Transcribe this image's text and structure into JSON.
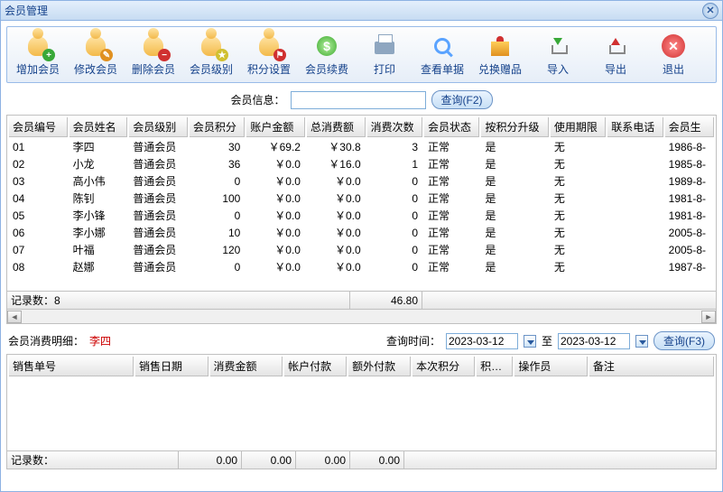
{
  "window": {
    "title": "会员管理"
  },
  "toolbar": [
    {
      "name": "add-member-button",
      "label": "增加会员",
      "icon": "person-add"
    },
    {
      "name": "edit-member-button",
      "label": "修改会员",
      "icon": "person-edit"
    },
    {
      "name": "delete-member-button",
      "label": "删除会员",
      "icon": "person-del"
    },
    {
      "name": "member-level-button",
      "label": "会员级别",
      "icon": "person-lvl"
    },
    {
      "name": "points-setting-button",
      "label": "积分设置",
      "icon": "person-pts"
    },
    {
      "name": "member-renew-button",
      "label": "会员续费",
      "icon": "coin"
    },
    {
      "name": "print-button",
      "label": "打印",
      "icon": "print"
    },
    {
      "name": "view-receipt-button",
      "label": "查看单据",
      "icon": "magnifier"
    },
    {
      "name": "exchange-gift-button",
      "label": "兑换赠品",
      "icon": "gift"
    },
    {
      "name": "import-button",
      "label": "导入",
      "icon": "arrow-in"
    },
    {
      "name": "export-button",
      "label": "导出",
      "icon": "arrow-out"
    },
    {
      "name": "exit-button",
      "label": "退出",
      "icon": "exit"
    }
  ],
  "search": {
    "label": "会员信息：",
    "value": "",
    "placeholder": "",
    "button": "查询(F2)"
  },
  "grid_top": {
    "columns": [
      "会员编号",
      "会员姓名",
      "会员级别",
      "会员积分",
      "账户金额",
      "总消费额",
      "消费次数",
      "会员状态",
      "按积分升级",
      "使用期限",
      "联系电话",
      "会员生"
    ],
    "rows": [
      {
        "id": "01",
        "name": "李四",
        "level": "普通会员",
        "points": "30",
        "balance": "￥69.2",
        "spent": "￥30.8",
        "times": "3",
        "status": "正常",
        "upgrade": "是",
        "expire": "无",
        "phone": "",
        "birth": "1986-8-"
      },
      {
        "id": "02",
        "name": "小龙",
        "level": "普通会员",
        "points": "36",
        "balance": "￥0.0",
        "spent": "￥16.0",
        "times": "1",
        "status": "正常",
        "upgrade": "是",
        "expire": "无",
        "phone": "",
        "birth": "1985-8-"
      },
      {
        "id": "03",
        "name": "高小伟",
        "level": "普通会员",
        "points": "0",
        "balance": "￥0.0",
        "spent": "￥0.0",
        "times": "0",
        "status": "正常",
        "upgrade": "是",
        "expire": "无",
        "phone": "",
        "birth": "1989-8-"
      },
      {
        "id": "04",
        "name": "陈钊",
        "level": "普通会员",
        "points": "100",
        "balance": "￥0.0",
        "spent": "￥0.0",
        "times": "0",
        "status": "正常",
        "upgrade": "是",
        "expire": "无",
        "phone": "",
        "birth": "1981-8-"
      },
      {
        "id": "05",
        "name": "李小锋",
        "level": "普通会员",
        "points": "0",
        "balance": "￥0.0",
        "spent": "￥0.0",
        "times": "0",
        "status": "正常",
        "upgrade": "是",
        "expire": "无",
        "phone": "",
        "birth": "1981-8-"
      },
      {
        "id": "06",
        "name": "李小娜",
        "level": "普通会员",
        "points": "10",
        "balance": "￥0.0",
        "spent": "￥0.0",
        "times": "0",
        "status": "正常",
        "upgrade": "是",
        "expire": "无",
        "phone": "",
        "birth": "2005-8-"
      },
      {
        "id": "07",
        "name": "叶福",
        "level": "普通会员",
        "points": "120",
        "balance": "￥0.0",
        "spent": "￥0.0",
        "times": "0",
        "status": "正常",
        "upgrade": "是",
        "expire": "无",
        "phone": "",
        "birth": "2005-8-"
      },
      {
        "id": "08",
        "name": "赵娜",
        "level": "普通会员",
        "points": "0",
        "balance": "￥0.0",
        "spent": "￥0.0",
        "times": "0",
        "status": "正常",
        "upgrade": "是",
        "expire": "无",
        "phone": "",
        "birth": "1987-8-"
      }
    ],
    "footer": {
      "count_label": "记录数：",
      "count": "8",
      "sum": "46.80"
    }
  },
  "detail": {
    "label": "会员消费明细：",
    "member_name": "李四",
    "date_label": "查询时间：",
    "date_from": "2023-03-12",
    "date_sep": "至",
    "date_to": "2023-03-12",
    "button": "查询(F3)"
  },
  "grid_bot": {
    "columns": [
      "销售单号",
      "销售日期",
      "消费金额",
      "帐户付款",
      "额外付款",
      "本次积分",
      "积…",
      "操作员",
      "备注"
    ],
    "footer": {
      "count_label": "记录数：",
      "v1": "0.00",
      "v2": "0.00",
      "v3": "0.00",
      "v4": "0.00"
    }
  }
}
